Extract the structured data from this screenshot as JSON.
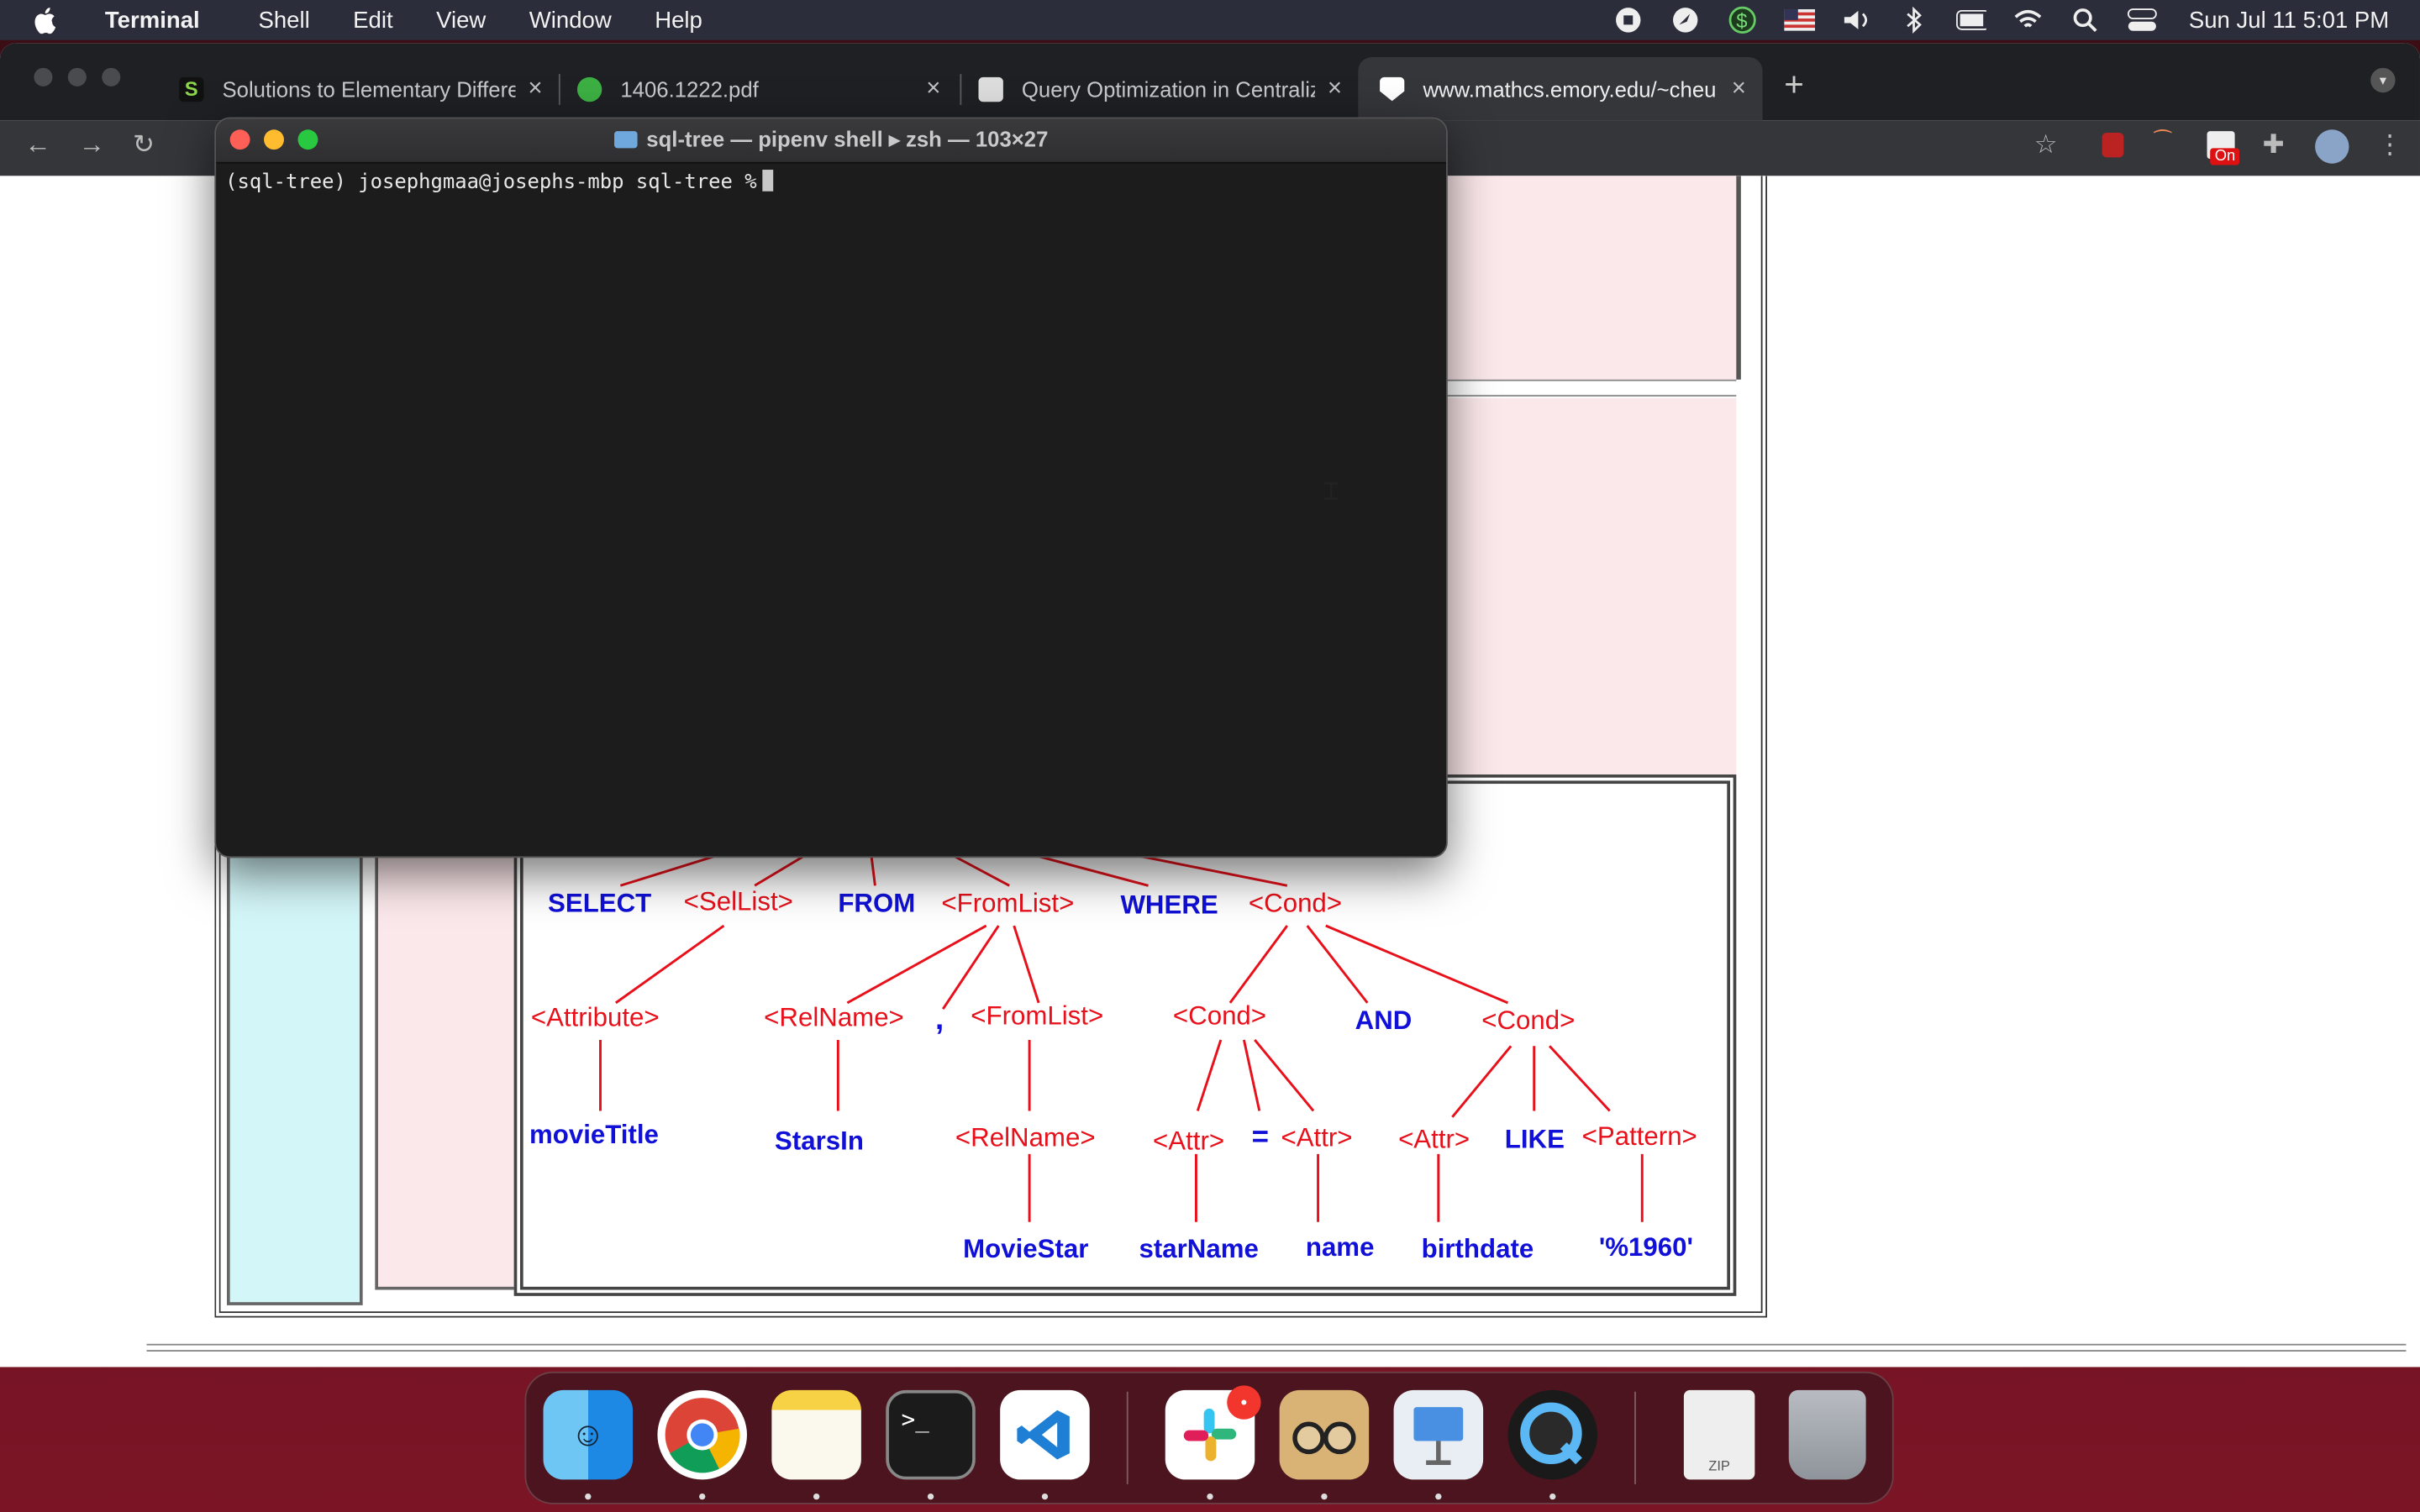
{
  "menubar": {
    "app_name": "Terminal",
    "items": [
      "Shell",
      "Edit",
      "View",
      "Window",
      "Help"
    ],
    "clock": "Sun Jul 11  5:01 PM"
  },
  "browser": {
    "tabs": [
      {
        "title": "Solutions to Elementary Differe",
        "favicon_color": "#1a1a1a"
      },
      {
        "title": "1406.1222.pdf",
        "favicon_color": "#3cb043"
      },
      {
        "title": "Query Optimization in Centraliz",
        "favicon_color": "#dddddd"
      },
      {
        "title": "www.mathcs.emory.edu/~cheu",
        "favicon_color": "#ffffff"
      }
    ],
    "new_tab_label": "+",
    "extension_badge": "On"
  },
  "terminal": {
    "title": "sql-tree — pipenv shell ▸ zsh — 103×27",
    "prompt": "(sql-tree) josephgmaa@josephs-mbp sql-tree %"
  },
  "parse_tree": {
    "level1": {
      "select": "SELECT",
      "sellist": "<SelList>",
      "from": "FROM",
      "fromlist": "<FromList>",
      "where": "WHERE",
      "cond": "<Cond>"
    },
    "level2": {
      "attribute": "<Attribute>",
      "relname": "<RelName>",
      "comma": ",",
      "fromlist": "<FromList>",
      "cond_left": "<Cond>",
      "and": "AND",
      "cond_right": "<Cond>"
    },
    "level3": {
      "movietitle": "movieTitle",
      "starsin": "StarsIn",
      "relname": "<RelName>",
      "attr1": "<Attr>",
      "eq": "=",
      "attr2": "<Attr>",
      "attr3": "<Attr>",
      "like": "LIKE",
      "pattern": "<Pattern>"
    },
    "level4": {
      "moviestar": "MovieStar",
      "starname": "starName",
      "name": "name",
      "birthdate": "birthdate",
      "pattern_value": "'%1960'"
    }
  },
  "dock": {
    "apps": [
      "finder-icon",
      "chrome-icon",
      "notes-icon",
      "terminal-icon",
      "vscode-icon",
      "slack-icon",
      "preview-icon",
      "keynote-icon",
      "quicktime-icon",
      "zip-archive-icon",
      "trash-icon"
    ],
    "slack_badge": "•",
    "zip_label": "ZIP"
  },
  "colors": {
    "nonterminal": "#e8101a",
    "keyword": "#1010d8",
    "desktop": "#6a1220"
  }
}
